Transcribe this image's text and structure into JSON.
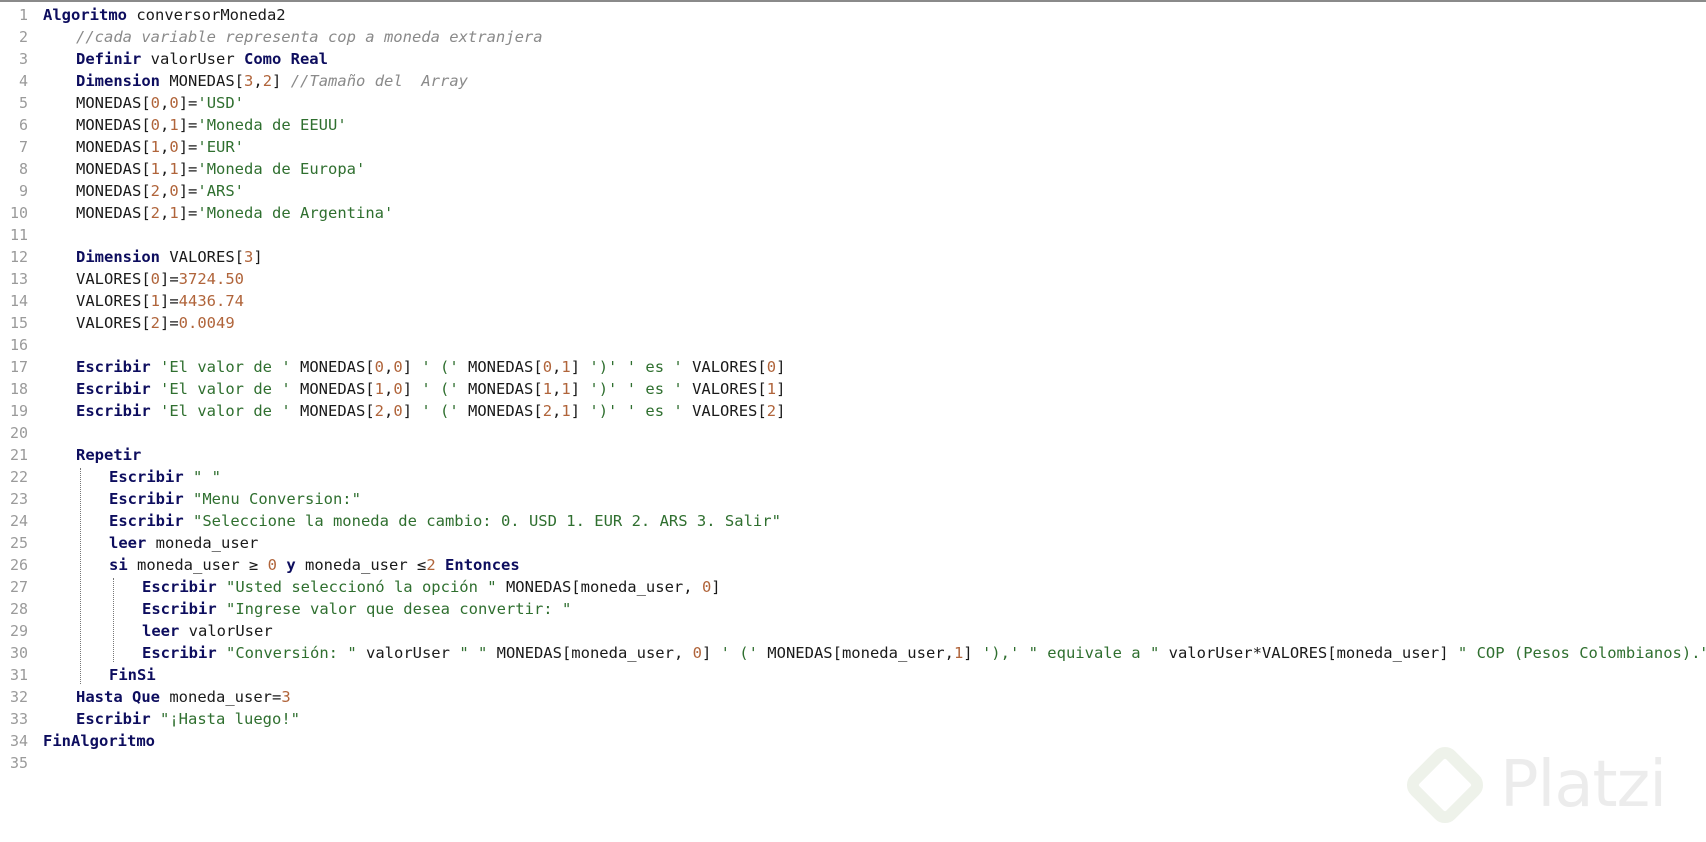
{
  "editor": {
    "lines": [
      {
        "n": "1",
        "indent": 0,
        "tokens": [
          {
            "t": "Algoritmo",
            "c": "kw"
          },
          {
            "t": " conversorMoneda2",
            "c": "id"
          }
        ]
      },
      {
        "n": "2",
        "indent": 1,
        "tokens": [
          {
            "t": "//cada variable representa cop a moneda extranjera",
            "c": "cm"
          }
        ]
      },
      {
        "n": "3",
        "indent": 1,
        "tokens": [
          {
            "t": "Definir",
            "c": "kw"
          },
          {
            "t": " valorUser ",
            "c": "id"
          },
          {
            "t": "Como Real",
            "c": "kw"
          }
        ]
      },
      {
        "n": "4",
        "indent": 1,
        "tokens": [
          {
            "t": "Dimension",
            "c": "kw"
          },
          {
            "t": " MONEDAS[",
            "c": "id"
          },
          {
            "t": "3",
            "c": "num"
          },
          {
            "t": ",",
            "c": "id"
          },
          {
            "t": "2",
            "c": "num"
          },
          {
            "t": "] ",
            "c": "id"
          },
          {
            "t": "//Tamaño del  Array",
            "c": "cm"
          }
        ]
      },
      {
        "n": "5",
        "indent": 1,
        "tokens": [
          {
            "t": "MONEDAS[",
            "c": "id"
          },
          {
            "t": "0",
            "c": "num"
          },
          {
            "t": ",",
            "c": "id"
          },
          {
            "t": "0",
            "c": "num"
          },
          {
            "t": "]=",
            "c": "id"
          },
          {
            "t": "'USD'",
            "c": "str"
          }
        ]
      },
      {
        "n": "6",
        "indent": 1,
        "tokens": [
          {
            "t": "MONEDAS[",
            "c": "id"
          },
          {
            "t": "0",
            "c": "num"
          },
          {
            "t": ",",
            "c": "id"
          },
          {
            "t": "1",
            "c": "num"
          },
          {
            "t": "]=",
            "c": "id"
          },
          {
            "t": "'Moneda de EEUU'",
            "c": "str"
          }
        ]
      },
      {
        "n": "7",
        "indent": 1,
        "tokens": [
          {
            "t": "MONEDAS[",
            "c": "id"
          },
          {
            "t": "1",
            "c": "num"
          },
          {
            "t": ",",
            "c": "id"
          },
          {
            "t": "0",
            "c": "num"
          },
          {
            "t": "]=",
            "c": "id"
          },
          {
            "t": "'EUR'",
            "c": "str"
          }
        ]
      },
      {
        "n": "8",
        "indent": 1,
        "tokens": [
          {
            "t": "MONEDAS[",
            "c": "id"
          },
          {
            "t": "1",
            "c": "num"
          },
          {
            "t": ",",
            "c": "id"
          },
          {
            "t": "1",
            "c": "num"
          },
          {
            "t": "]=",
            "c": "id"
          },
          {
            "t": "'Moneda de Europa'",
            "c": "str"
          }
        ]
      },
      {
        "n": "9",
        "indent": 1,
        "tokens": [
          {
            "t": "MONEDAS[",
            "c": "id"
          },
          {
            "t": "2",
            "c": "num"
          },
          {
            "t": ",",
            "c": "id"
          },
          {
            "t": "0",
            "c": "num"
          },
          {
            "t": "]=",
            "c": "id"
          },
          {
            "t": "'ARS'",
            "c": "str"
          }
        ]
      },
      {
        "n": "10",
        "indent": 1,
        "tokens": [
          {
            "t": "MONEDAS[",
            "c": "id"
          },
          {
            "t": "2",
            "c": "num"
          },
          {
            "t": ",",
            "c": "id"
          },
          {
            "t": "1",
            "c": "num"
          },
          {
            "t": "]=",
            "c": "id"
          },
          {
            "t": "'Moneda de Argentina'",
            "c": "str"
          }
        ]
      },
      {
        "n": "11",
        "indent": 0,
        "tokens": []
      },
      {
        "n": "12",
        "indent": 1,
        "tokens": [
          {
            "t": "Dimension",
            "c": "kw"
          },
          {
            "t": " VALORES[",
            "c": "id"
          },
          {
            "t": "3",
            "c": "num"
          },
          {
            "t": "]",
            "c": "id"
          }
        ]
      },
      {
        "n": "13",
        "indent": 1,
        "tokens": [
          {
            "t": "VALORES[",
            "c": "id"
          },
          {
            "t": "0",
            "c": "num"
          },
          {
            "t": "]=",
            "c": "id"
          },
          {
            "t": "3724.50",
            "c": "num"
          }
        ]
      },
      {
        "n": "14",
        "indent": 1,
        "tokens": [
          {
            "t": "VALORES[",
            "c": "id"
          },
          {
            "t": "1",
            "c": "num"
          },
          {
            "t": "]=",
            "c": "id"
          },
          {
            "t": "4436.74",
            "c": "num"
          }
        ]
      },
      {
        "n": "15",
        "indent": 1,
        "tokens": [
          {
            "t": "VALORES[",
            "c": "id"
          },
          {
            "t": "2",
            "c": "num"
          },
          {
            "t": "]=",
            "c": "id"
          },
          {
            "t": "0.0049",
            "c": "num"
          }
        ]
      },
      {
        "n": "16",
        "indent": 0,
        "tokens": []
      },
      {
        "n": "17",
        "indent": 1,
        "tokens": [
          {
            "t": "Escribir",
            "c": "kw"
          },
          {
            "t": " ",
            "c": "id"
          },
          {
            "t": "'El valor de '",
            "c": "str"
          },
          {
            "t": " MONEDAS[",
            "c": "id"
          },
          {
            "t": "0",
            "c": "num"
          },
          {
            "t": ",",
            "c": "id"
          },
          {
            "t": "0",
            "c": "num"
          },
          {
            "t": "] ",
            "c": "id"
          },
          {
            "t": "' ('",
            "c": "str"
          },
          {
            "t": " MONEDAS[",
            "c": "id"
          },
          {
            "t": "0",
            "c": "num"
          },
          {
            "t": ",",
            "c": "id"
          },
          {
            "t": "1",
            "c": "num"
          },
          {
            "t": "] ",
            "c": "id"
          },
          {
            "t": "')'",
            "c": "str"
          },
          {
            "t": " ",
            "c": "id"
          },
          {
            "t": "' es '",
            "c": "str"
          },
          {
            "t": " VALORES[",
            "c": "id"
          },
          {
            "t": "0",
            "c": "num"
          },
          {
            "t": "]",
            "c": "id"
          }
        ]
      },
      {
        "n": "18",
        "indent": 1,
        "tokens": [
          {
            "t": "Escribir",
            "c": "kw"
          },
          {
            "t": " ",
            "c": "id"
          },
          {
            "t": "'El valor de '",
            "c": "str"
          },
          {
            "t": " MONEDAS[",
            "c": "id"
          },
          {
            "t": "1",
            "c": "num"
          },
          {
            "t": ",",
            "c": "id"
          },
          {
            "t": "0",
            "c": "num"
          },
          {
            "t": "] ",
            "c": "id"
          },
          {
            "t": "' ('",
            "c": "str"
          },
          {
            "t": " MONEDAS[",
            "c": "id"
          },
          {
            "t": "1",
            "c": "num"
          },
          {
            "t": ",",
            "c": "id"
          },
          {
            "t": "1",
            "c": "num"
          },
          {
            "t": "] ",
            "c": "id"
          },
          {
            "t": "')'",
            "c": "str"
          },
          {
            "t": " ",
            "c": "id"
          },
          {
            "t": "' es '",
            "c": "str"
          },
          {
            "t": " VALORES[",
            "c": "id"
          },
          {
            "t": "1",
            "c": "num"
          },
          {
            "t": "]",
            "c": "id"
          }
        ]
      },
      {
        "n": "19",
        "indent": 1,
        "tokens": [
          {
            "t": "Escribir",
            "c": "kw"
          },
          {
            "t": " ",
            "c": "id"
          },
          {
            "t": "'El valor de '",
            "c": "str"
          },
          {
            "t": " MONEDAS[",
            "c": "id"
          },
          {
            "t": "2",
            "c": "num"
          },
          {
            "t": ",",
            "c": "id"
          },
          {
            "t": "0",
            "c": "num"
          },
          {
            "t": "] ",
            "c": "id"
          },
          {
            "t": "' ('",
            "c": "str"
          },
          {
            "t": " MONEDAS[",
            "c": "id"
          },
          {
            "t": "2",
            "c": "num"
          },
          {
            "t": ",",
            "c": "id"
          },
          {
            "t": "1",
            "c": "num"
          },
          {
            "t": "] ",
            "c": "id"
          },
          {
            "t": "')'",
            "c": "str"
          },
          {
            "t": " ",
            "c": "id"
          },
          {
            "t": "' es '",
            "c": "str"
          },
          {
            "t": " VALORES[",
            "c": "id"
          },
          {
            "t": "2",
            "c": "num"
          },
          {
            "t": "]",
            "c": "id"
          }
        ]
      },
      {
        "n": "20",
        "indent": 0,
        "tokens": []
      },
      {
        "n": "21",
        "indent": 1,
        "tokens": [
          {
            "t": "Repetir",
            "c": "kw"
          }
        ]
      },
      {
        "n": "22",
        "indent": 2,
        "tokens": [
          {
            "t": "Escribir",
            "c": "kw"
          },
          {
            "t": " ",
            "c": "id"
          },
          {
            "t": "\" \"",
            "c": "str"
          }
        ]
      },
      {
        "n": "23",
        "indent": 2,
        "tokens": [
          {
            "t": "Escribir",
            "c": "kw"
          },
          {
            "t": " ",
            "c": "id"
          },
          {
            "t": "\"Menu Conversion:\"",
            "c": "str"
          }
        ]
      },
      {
        "n": "24",
        "indent": 2,
        "tokens": [
          {
            "t": "Escribir",
            "c": "kw"
          },
          {
            "t": " ",
            "c": "id"
          },
          {
            "t": "\"Seleccione la moneda de cambio: 0. USD 1. EUR 2. ARS 3. Salir\"",
            "c": "str"
          }
        ]
      },
      {
        "n": "25",
        "indent": 2,
        "tokens": [
          {
            "t": "leer",
            "c": "kw"
          },
          {
            "t": " moneda_user",
            "c": "id"
          }
        ]
      },
      {
        "n": "26",
        "indent": 2,
        "tokens": [
          {
            "t": "si",
            "c": "kw"
          },
          {
            "t": " moneda_user ≥ ",
            "c": "id"
          },
          {
            "t": "0",
            "c": "num"
          },
          {
            "t": " ",
            "c": "id"
          },
          {
            "t": "y",
            "c": "kw"
          },
          {
            "t": " moneda_user ≤",
            "c": "id"
          },
          {
            "t": "2",
            "c": "num"
          },
          {
            "t": " ",
            "c": "id"
          },
          {
            "t": "Entonces",
            "c": "kw"
          }
        ]
      },
      {
        "n": "27",
        "indent": 3,
        "tokens": [
          {
            "t": "Escribir",
            "c": "kw"
          },
          {
            "t": " ",
            "c": "id"
          },
          {
            "t": "\"Usted seleccionó la opción \"",
            "c": "str"
          },
          {
            "t": " MONEDAS[moneda_user, ",
            "c": "id"
          },
          {
            "t": "0",
            "c": "num"
          },
          {
            "t": "]",
            "c": "id"
          }
        ]
      },
      {
        "n": "28",
        "indent": 3,
        "tokens": [
          {
            "t": "Escribir",
            "c": "kw"
          },
          {
            "t": " ",
            "c": "id"
          },
          {
            "t": "\"Ingrese valor que desea convertir: \"",
            "c": "str"
          }
        ]
      },
      {
        "n": "29",
        "indent": 3,
        "tokens": [
          {
            "t": "leer",
            "c": "kw"
          },
          {
            "t": " valorUser",
            "c": "id"
          }
        ]
      },
      {
        "n": "30",
        "indent": 3,
        "tokens": [
          {
            "t": "Escribir",
            "c": "kw"
          },
          {
            "t": " ",
            "c": "id"
          },
          {
            "t": "\"Conversión: \"",
            "c": "str"
          },
          {
            "t": " valorUser ",
            "c": "id"
          },
          {
            "t": "\" \"",
            "c": "str"
          },
          {
            "t": " MONEDAS[moneda_user, ",
            "c": "id"
          },
          {
            "t": "0",
            "c": "num"
          },
          {
            "t": "] ",
            "c": "id"
          },
          {
            "t": "' ('",
            "c": "str"
          },
          {
            "t": " MONEDAS[moneda_user,",
            "c": "id"
          },
          {
            "t": "1",
            "c": "num"
          },
          {
            "t": "] ",
            "c": "id"
          },
          {
            "t": "'),'",
            "c": "str"
          },
          {
            "t": " ",
            "c": "id"
          },
          {
            "t": "\" equivale a \"",
            "c": "str"
          },
          {
            "t": " valorUser*VALORES[moneda_user] ",
            "c": "id"
          },
          {
            "t": "\" COP (Pesos Colombianos).\"",
            "c": "str"
          }
        ]
      },
      {
        "n": "31",
        "indent": 2,
        "tokens": [
          {
            "t": "FinSi",
            "c": "kw"
          }
        ]
      },
      {
        "n": "32",
        "indent": 1,
        "tokens": [
          {
            "t": "Hasta Que",
            "c": "kw"
          },
          {
            "t": " moneda_user=",
            "c": "id"
          },
          {
            "t": "3",
            "c": "num"
          }
        ]
      },
      {
        "n": "33",
        "indent": 1,
        "tokens": [
          {
            "t": "Escribir",
            "c": "kw"
          },
          {
            "t": " ",
            "c": "id"
          },
          {
            "t": "\"¡Hasta luego!\"",
            "c": "str"
          }
        ]
      },
      {
        "n": "34",
        "indent": 0,
        "tokens": [
          {
            "t": "FinAlgoritmo",
            "c": "kw"
          }
        ]
      },
      {
        "n": "35",
        "indent": 0,
        "tokens": []
      }
    ]
  },
  "watermark": {
    "text": "Platzi",
    "logo_icon": "platzi-logo-icon"
  },
  "colors": {
    "keyword": "#0d0d5e",
    "string": "#2f6f2f",
    "number": "#b0643a",
    "comment": "#8a8a8a",
    "line_number": "#9a9a9a"
  }
}
